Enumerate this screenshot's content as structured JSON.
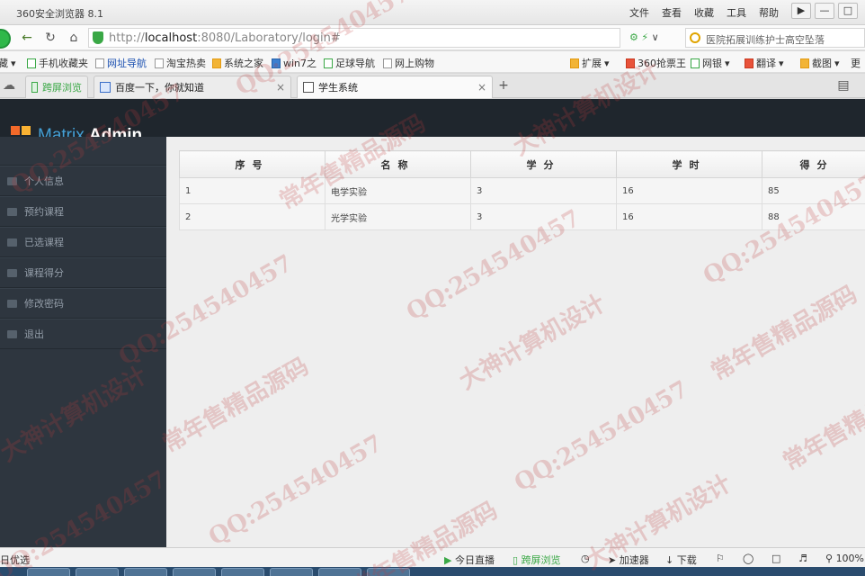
{
  "browser": {
    "title": "360安全浏览器 8.1",
    "menus": [
      "文件",
      "查看",
      "收藏",
      "工具",
      "帮助"
    ],
    "address_host": "http://",
    "address_bold": "localhost",
    "address_rest": ":8080/Laboratory/login#",
    "search_text": "医院拓展训练护士高空坠落",
    "bookmarks": [
      "藏",
      "手机收藏夹",
      "网址导航",
      "淘宝热卖",
      "系统之家",
      "win7之",
      "足球导航",
      "网上购物",
      "扩展",
      "360抢票王",
      "网银",
      "翻译",
      "截图",
      "更"
    ],
    "tabs": [
      "跨屏浏览",
      "百度一下，你就知道",
      "学生系统"
    ],
    "status": {
      "left": "日优选",
      "live": "今日直播",
      "cross": "跨屏浏览",
      "accelerate": "加速器",
      "download": "下载",
      "zoom": "100%"
    }
  },
  "app": {
    "brand_part1": "Matrix",
    "brand_part2": "Admin",
    "sidebar": [
      {
        "label": "个人信息",
        "icon": "inbox-icon"
      },
      {
        "label": "预约课程",
        "icon": "group-icon"
      },
      {
        "label": "已选课程",
        "icon": "flag-icon"
      },
      {
        "label": "课程得分",
        "icon": "tag-icon"
      },
      {
        "label": "修改密码",
        "icon": "magnet-icon"
      },
      {
        "label": "退出",
        "icon": "film-icon"
      }
    ],
    "table": {
      "headers": [
        "序号",
        "名称",
        "学分",
        "学时",
        "得分"
      ],
      "rows": [
        [
          "1",
          "电学实验",
          "3",
          "16",
          "85"
        ],
        [
          "2",
          "光学实验",
          "3",
          "16",
          "88"
        ]
      ]
    }
  },
  "watermarks": [
    "QQ:254540457",
    "常年售精品源码",
    "大神计算机设计"
  ]
}
